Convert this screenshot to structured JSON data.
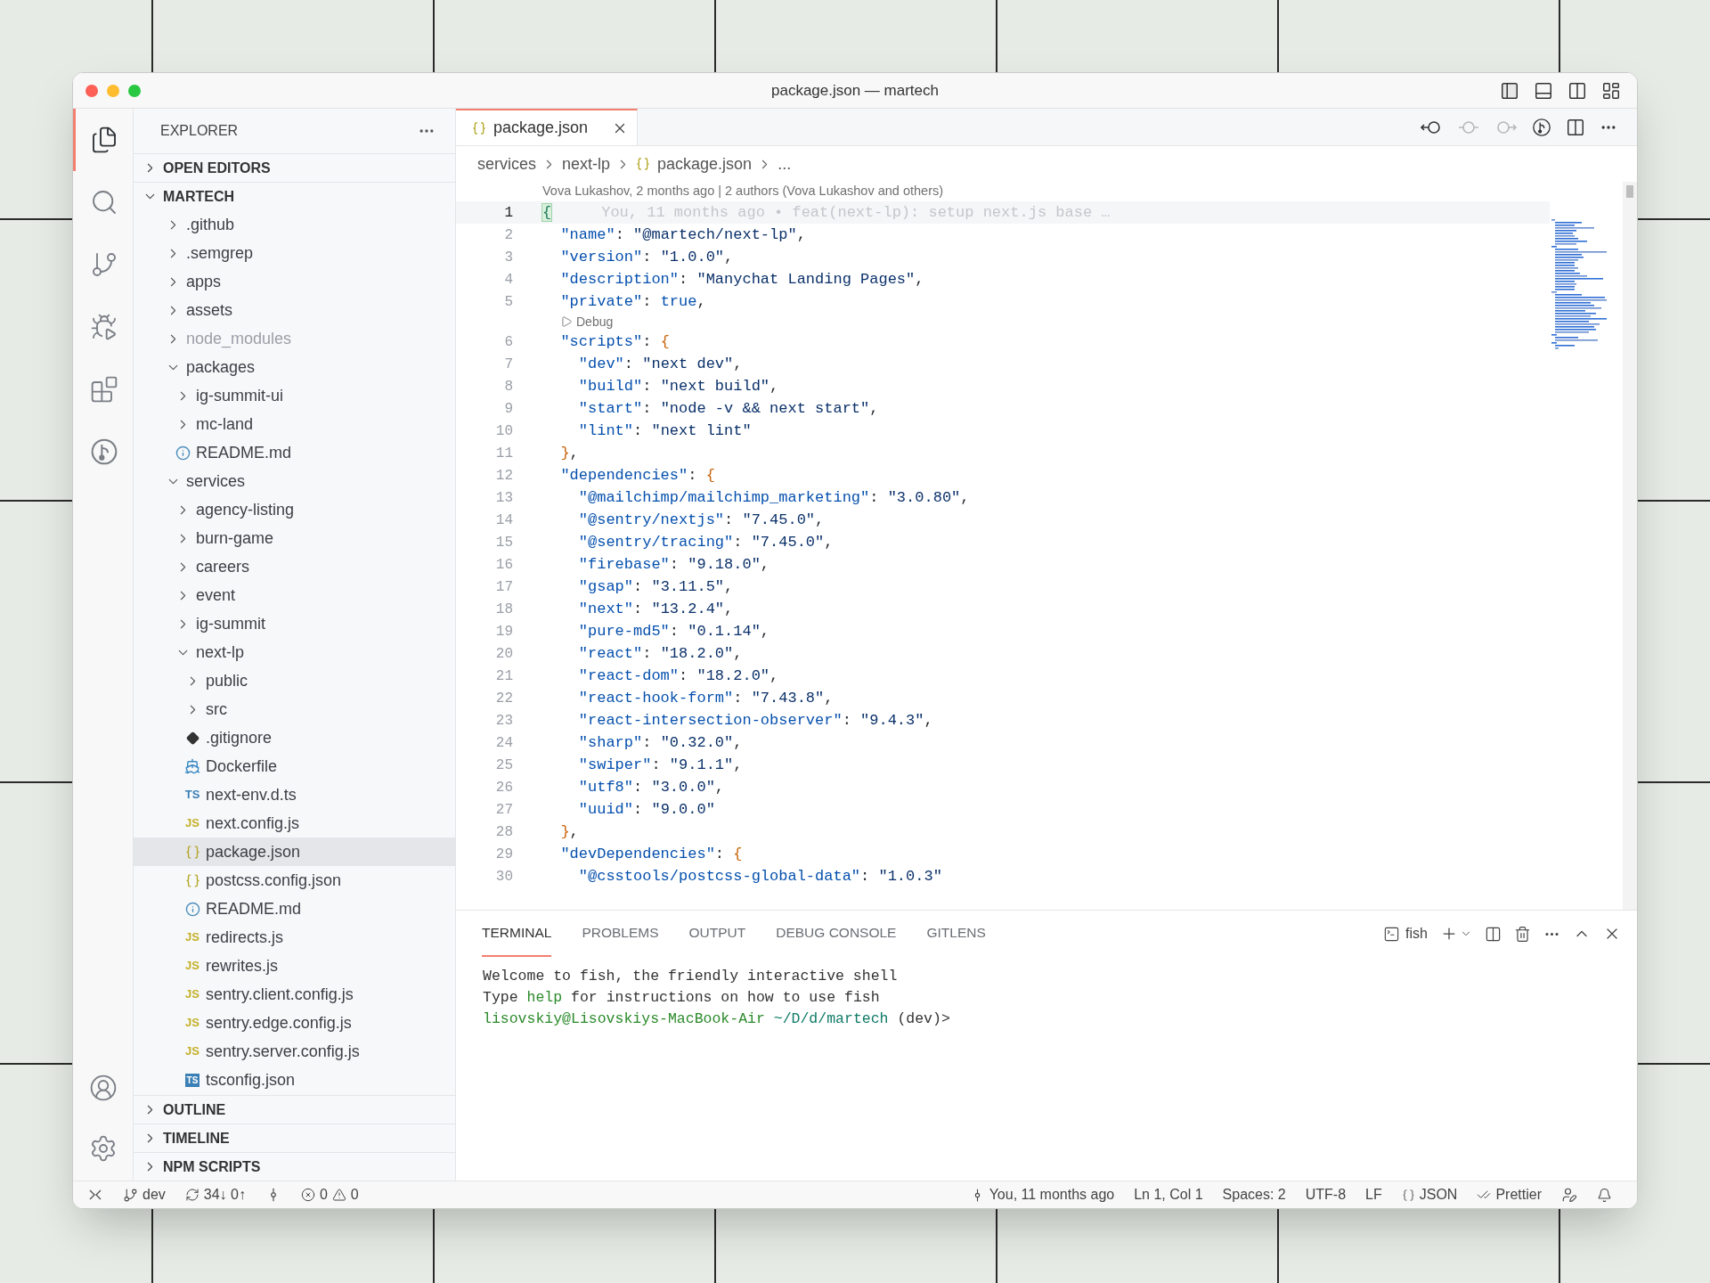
{
  "window": {
    "title": "package.json — martech"
  },
  "activity_bar": [
    {
      "kind": "explorer",
      "selected": true
    },
    {
      "kind": "search",
      "selected": false
    },
    {
      "kind": "source-control",
      "selected": false
    },
    {
      "kind": "run-debug",
      "selected": false
    },
    {
      "kind": "extensions",
      "selected": false
    },
    {
      "kind": "gitlens",
      "selected": false
    }
  ],
  "activity_bar_bottom": [
    {
      "kind": "account"
    },
    {
      "kind": "settings"
    }
  ],
  "sidebar": {
    "title": "EXPLORER",
    "sections_top": [
      {
        "label": "OPEN EDITORS",
        "expanded": false
      }
    ],
    "workspace": {
      "label": "MARTECH",
      "expanded": true
    },
    "tree": [
      {
        "label": ".github",
        "kind": "folder",
        "expanded": false,
        "ignored": false,
        "selected": false
      },
      {
        "label": ".semgrep",
        "kind": "folder",
        "expanded": false,
        "ignored": false,
        "selected": false
      },
      {
        "label": "apps",
        "kind": "folder",
        "expanded": false,
        "ignored": false,
        "selected": false
      },
      {
        "label": "assets",
        "kind": "folder",
        "expanded": false,
        "ignored": false,
        "selected": false
      },
      {
        "label": "node_modules",
        "kind": "folder",
        "expanded": false,
        "ignored": true,
        "selected": false
      },
      {
        "label": "packages",
        "kind": "folder",
        "expanded": true,
        "ignored": false,
        "selected": false,
        "children": [
          {
            "label": "ig-summit-ui",
            "kind": "folder",
            "expanded": false,
            "ignored": false,
            "selected": false
          },
          {
            "label": "mc-land",
            "kind": "folder",
            "expanded": false,
            "ignored": false,
            "selected": false
          },
          {
            "label": "README.md",
            "kind": "info",
            "ignored": false,
            "selected": false
          }
        ]
      },
      {
        "label": "services",
        "kind": "folder",
        "expanded": true,
        "ignored": false,
        "selected": false,
        "children": [
          {
            "label": "agency-listing",
            "kind": "folder",
            "expanded": false,
            "ignored": false,
            "selected": false
          },
          {
            "label": "burn-game",
            "kind": "folder",
            "expanded": false,
            "ignored": false,
            "selected": false
          },
          {
            "label": "careers",
            "kind": "folder",
            "expanded": false,
            "ignored": false,
            "selected": false
          },
          {
            "label": "event",
            "kind": "folder",
            "expanded": false,
            "ignored": false,
            "selected": false
          },
          {
            "label": "ig-summit",
            "kind": "folder",
            "expanded": false,
            "ignored": false,
            "selected": false
          },
          {
            "label": "next-lp",
            "kind": "folder",
            "expanded": true,
            "ignored": false,
            "selected": false,
            "children": [
              {
                "label": "public",
                "kind": "folder",
                "expanded": false,
                "ignored": false,
                "selected": false
              },
              {
                "label": "src",
                "kind": "folder",
                "expanded": false,
                "ignored": false,
                "selected": false
              },
              {
                "label": ".gitignore",
                "kind": "git",
                "ignored": false,
                "selected": false
              },
              {
                "label": "Dockerfile",
                "kind": "docker",
                "ignored": false,
                "selected": false
              },
              {
                "label": "next-env.d.ts",
                "kind": "ts",
                "glyph": "TS",
                "ignored": false,
                "selected": false
              },
              {
                "label": "next.config.js",
                "kind": "js",
                "glyph": "JS",
                "ignored": false,
                "selected": false
              },
              {
                "label": "package.json",
                "kind": "json",
                "ignored": false,
                "selected": true
              },
              {
                "label": "postcss.config.json",
                "kind": "json",
                "ignored": false,
                "selected": false
              },
              {
                "label": "README.md",
                "kind": "info",
                "ignored": false,
                "selected": false
              },
              {
                "label": "redirects.js",
                "kind": "js",
                "glyph": "JS",
                "ignored": false,
                "selected": false
              },
              {
                "label": "rewrites.js",
                "kind": "js",
                "glyph": "JS",
                "ignored": false,
                "selected": false
              },
              {
                "label": "sentry.client.config.js",
                "kind": "js",
                "glyph": "JS",
                "ignored": false,
                "selected": false
              },
              {
                "label": "sentry.edge.config.js",
                "kind": "js",
                "glyph": "JS",
                "ignored": false,
                "selected": false
              },
              {
                "label": "sentry.server.config.js",
                "kind": "js",
                "glyph": "JS",
                "ignored": false,
                "selected": false
              },
              {
                "label": "tsconfig.json",
                "kind": "tsbox",
                "glyph": "TS",
                "ignored": false,
                "selected": false
              }
            ]
          }
        ]
      }
    ],
    "sections_bottom": [
      {
        "label": "OUTLINE",
        "expanded": false
      },
      {
        "label": "TIMELINE",
        "expanded": false
      },
      {
        "label": "NPM SCRIPTS",
        "expanded": false
      }
    ]
  },
  "tabs": [
    {
      "label": "package.json",
      "kind": "json",
      "selected": true
    }
  ],
  "breadcrumbs": [
    {
      "label": "services",
      "kind": "folder"
    },
    {
      "label": "next-lp",
      "kind": "folder"
    },
    {
      "label": "package.json",
      "kind": "json"
    },
    {
      "label": "...",
      "kind": "symbol"
    }
  ],
  "editor": {
    "blame_header": "Vova Lukashov, 2 months ago | 2 authors (Vova Lukashov and others)",
    "lines": [
      {
        "number": "1",
        "current": true,
        "blame": "You, 11 months ago • feat(next-lp): setup next.js base …",
        "tokens": [
          {
            "text": "{",
            "kind": "match"
          }
        ]
      },
      {
        "number": "2",
        "current": false,
        "tokens": [
          {
            "text": "  \"name\"",
            "kind": "key"
          },
          {
            "text": ": ",
            "kind": "punct"
          },
          {
            "text": "\"@martech/next-lp\"",
            "kind": "str"
          },
          {
            "text": ",",
            "kind": "punct"
          }
        ]
      },
      {
        "number": "3",
        "current": false,
        "tokens": [
          {
            "text": "  \"version\"",
            "kind": "key"
          },
          {
            "text": ": ",
            "kind": "punct"
          },
          {
            "text": "\"1.0.0\"",
            "kind": "str"
          },
          {
            "text": ",",
            "kind": "punct"
          }
        ]
      },
      {
        "number": "4",
        "current": false,
        "tokens": [
          {
            "text": "  \"description\"",
            "kind": "key"
          },
          {
            "text": ": ",
            "kind": "punct"
          },
          {
            "text": "\"Manychat Landing Pages\"",
            "kind": "str"
          },
          {
            "text": ",",
            "kind": "punct"
          }
        ]
      },
      {
        "number": "5",
        "current": false,
        "lens": "Debug",
        "tokens": [
          {
            "text": "  \"private\"",
            "kind": "key"
          },
          {
            "text": ": ",
            "kind": "punct"
          },
          {
            "text": "true",
            "kind": "kw"
          },
          {
            "text": ",",
            "kind": "punct"
          }
        ]
      },
      {
        "number": "6",
        "current": false,
        "tokens": [
          {
            "text": "  \"scripts\"",
            "kind": "key"
          },
          {
            "text": ": ",
            "kind": "punct"
          },
          {
            "text": "{",
            "kind": "bracket"
          }
        ]
      },
      {
        "number": "7",
        "current": false,
        "tokens": [
          {
            "text": "    \"dev\"",
            "kind": "key"
          },
          {
            "text": ": ",
            "kind": "punct"
          },
          {
            "text": "\"next dev\"",
            "kind": "str"
          },
          {
            "text": ",",
            "kind": "punct"
          }
        ]
      },
      {
        "number": "8",
        "current": false,
        "tokens": [
          {
            "text": "    \"build\"",
            "kind": "key"
          },
          {
            "text": ": ",
            "kind": "punct"
          },
          {
            "text": "\"next build\"",
            "kind": "str"
          },
          {
            "text": ",",
            "kind": "punct"
          }
        ]
      },
      {
        "number": "9",
        "current": false,
        "tokens": [
          {
            "text": "    \"start\"",
            "kind": "key"
          },
          {
            "text": ": ",
            "kind": "punct"
          },
          {
            "text": "\"node -v && next start\"",
            "kind": "str"
          },
          {
            "text": ",",
            "kind": "punct"
          }
        ]
      },
      {
        "number": "10",
        "current": false,
        "tokens": [
          {
            "text": "    \"lint\"",
            "kind": "key"
          },
          {
            "text": ": ",
            "kind": "punct"
          },
          {
            "text": "\"next lint\"",
            "kind": "str"
          }
        ]
      },
      {
        "number": "11",
        "current": false,
        "tokens": [
          {
            "text": "  }",
            "kind": "bracket"
          },
          {
            "text": ",",
            "kind": "punct"
          }
        ]
      },
      {
        "number": "12",
        "current": false,
        "tokens": [
          {
            "text": "  \"dependencies\"",
            "kind": "key"
          },
          {
            "text": ": ",
            "kind": "punct"
          },
          {
            "text": "{",
            "kind": "bracket"
          }
        ]
      },
      {
        "number": "13",
        "current": false,
        "tokens": [
          {
            "text": "    \"@mailchimp/mailchimp_marketing\"",
            "kind": "key"
          },
          {
            "text": ": ",
            "kind": "punct"
          },
          {
            "text": "\"3.0.80\"",
            "kind": "str"
          },
          {
            "text": ",",
            "kind": "punct"
          }
        ]
      },
      {
        "number": "14",
        "current": false,
        "tokens": [
          {
            "text": "    \"@sentry/nextjs\"",
            "kind": "key"
          },
          {
            "text": ": ",
            "kind": "punct"
          },
          {
            "text": "\"7.45.0\"",
            "kind": "str"
          },
          {
            "text": ",",
            "kind": "punct"
          }
        ]
      },
      {
        "number": "15",
        "current": false,
        "tokens": [
          {
            "text": "    \"@sentry/tracing\"",
            "kind": "key"
          },
          {
            "text": ": ",
            "kind": "punct"
          },
          {
            "text": "\"7.45.0\"",
            "kind": "str"
          },
          {
            "text": ",",
            "kind": "punct"
          }
        ]
      },
      {
        "number": "16",
        "current": false,
        "tokens": [
          {
            "text": "    \"firebase\"",
            "kind": "key"
          },
          {
            "text": ": ",
            "kind": "punct"
          },
          {
            "text": "\"9.18.0\"",
            "kind": "str"
          },
          {
            "text": ",",
            "kind": "punct"
          }
        ]
      },
      {
        "number": "17",
        "current": false,
        "tokens": [
          {
            "text": "    \"gsap\"",
            "kind": "key"
          },
          {
            "text": ": ",
            "kind": "punct"
          },
          {
            "text": "\"3.11.5\"",
            "kind": "str"
          },
          {
            "text": ",",
            "kind": "punct"
          }
        ]
      },
      {
        "number": "18",
        "current": false,
        "tokens": [
          {
            "text": "    \"next\"",
            "kind": "key"
          },
          {
            "text": ": ",
            "kind": "punct"
          },
          {
            "text": "\"13.2.4\"",
            "kind": "str"
          },
          {
            "text": ",",
            "kind": "punct"
          }
        ]
      },
      {
        "number": "19",
        "current": false,
        "tokens": [
          {
            "text": "    \"pure-md5\"",
            "kind": "key"
          },
          {
            "text": ": ",
            "kind": "punct"
          },
          {
            "text": "\"0.1.14\"",
            "kind": "str"
          },
          {
            "text": ",",
            "kind": "punct"
          }
        ]
      },
      {
        "number": "20",
        "current": false,
        "tokens": [
          {
            "text": "    \"react\"",
            "kind": "key"
          },
          {
            "text": ": ",
            "kind": "punct"
          },
          {
            "text": "\"18.2.0\"",
            "kind": "str"
          },
          {
            "text": ",",
            "kind": "punct"
          }
        ]
      },
      {
        "number": "21",
        "current": false,
        "tokens": [
          {
            "text": "    \"react-dom\"",
            "kind": "key"
          },
          {
            "text": ": ",
            "kind": "punct"
          },
          {
            "text": "\"18.2.0\"",
            "kind": "str"
          },
          {
            "text": ",",
            "kind": "punct"
          }
        ]
      },
      {
        "number": "22",
        "current": false,
        "tokens": [
          {
            "text": "    \"react-hook-form\"",
            "kind": "key"
          },
          {
            "text": ": ",
            "kind": "punct"
          },
          {
            "text": "\"7.43.8\"",
            "kind": "str"
          },
          {
            "text": ",",
            "kind": "punct"
          }
        ]
      },
      {
        "number": "23",
        "current": false,
        "tokens": [
          {
            "text": "    \"react-intersection-observer\"",
            "kind": "key"
          },
          {
            "text": ": ",
            "kind": "punct"
          },
          {
            "text": "\"9.4.3\"",
            "kind": "str"
          },
          {
            "text": ",",
            "kind": "punct"
          }
        ]
      },
      {
        "number": "24",
        "current": false,
        "tokens": [
          {
            "text": "    \"sharp\"",
            "kind": "key"
          },
          {
            "text": ": ",
            "kind": "punct"
          },
          {
            "text": "\"0.32.0\"",
            "kind": "str"
          },
          {
            "text": ",",
            "kind": "punct"
          }
        ]
      },
      {
        "number": "25",
        "current": false,
        "tokens": [
          {
            "text": "    \"swiper\"",
            "kind": "key"
          },
          {
            "text": ": ",
            "kind": "punct"
          },
          {
            "text": "\"9.1.1\"",
            "kind": "str"
          },
          {
            "text": ",",
            "kind": "punct"
          }
        ]
      },
      {
        "number": "26",
        "current": false,
        "tokens": [
          {
            "text": "    \"utf8\"",
            "kind": "key"
          },
          {
            "text": ": ",
            "kind": "punct"
          },
          {
            "text": "\"3.0.0\"",
            "kind": "str"
          },
          {
            "text": ",",
            "kind": "punct"
          }
        ]
      },
      {
        "number": "27",
        "current": false,
        "tokens": [
          {
            "text": "    \"uuid\"",
            "kind": "key"
          },
          {
            "text": ": ",
            "kind": "punct"
          },
          {
            "text": "\"9.0.0\"",
            "kind": "str"
          }
        ]
      },
      {
        "number": "28",
        "current": false,
        "tokens": [
          {
            "text": "  }",
            "kind": "bracket"
          },
          {
            "text": ",",
            "kind": "punct"
          }
        ]
      },
      {
        "number": "29",
        "current": false,
        "tokens": [
          {
            "text": "  \"devDependencies\"",
            "kind": "key"
          },
          {
            "text": ": ",
            "kind": "punct"
          },
          {
            "text": "{",
            "kind": "bracket"
          }
        ]
      },
      {
        "number": "30",
        "current": false,
        "tokens": [
          {
            "text": "    \"@csstools/postcss-global-data\"",
            "kind": "key"
          },
          {
            "text": ": ",
            "kind": "punct"
          },
          {
            "text": "\"1.0.3\"",
            "kind": "str"
          }
        ]
      }
    ]
  },
  "panel": {
    "tabs": [
      {
        "label": "TERMINAL",
        "selected": true
      },
      {
        "label": "PROBLEMS",
        "selected": false
      },
      {
        "label": "OUTPUT",
        "selected": false
      },
      {
        "label": "DEBUG CONSOLE",
        "selected": false
      },
      {
        "label": "GITLENS",
        "selected": false
      }
    ],
    "terminal_profile": "fish",
    "terminal_lines": [
      [
        {
          "text": "Welcome to fish, the friendly interactive shell",
          "kind": "plain"
        }
      ],
      [
        {
          "text": "Type ",
          "kind": "plain"
        },
        {
          "text": "help",
          "kind": "green"
        },
        {
          "text": " for instructions on how to use fish",
          "kind": "plain"
        }
      ],
      [
        {
          "text": "lisovskiy@Lisovskiys-MacBook-Air",
          "kind": "green"
        },
        {
          "text": " ~/D/d/martech",
          "kind": "teal"
        },
        {
          "text": " (dev)>",
          "kind": "plain"
        }
      ]
    ]
  },
  "status_bar": {
    "left": [
      {
        "kind": "remote"
      },
      {
        "kind": "branch",
        "text": "dev"
      },
      {
        "kind": "sync",
        "text": "34↓ 0↑"
      },
      {
        "kind": "graph"
      },
      {
        "kind": "problems",
        "errors": "0",
        "warnings": "0"
      }
    ],
    "right": [
      {
        "kind": "blame",
        "text": "You, 11 months ago"
      },
      {
        "kind": "text",
        "text": "Ln 1, Col 1"
      },
      {
        "kind": "text",
        "text": "Spaces: 2"
      },
      {
        "kind": "text",
        "text": "UTF-8"
      },
      {
        "kind": "text",
        "text": "LF"
      },
      {
        "kind": "language",
        "text": "JSON"
      },
      {
        "kind": "formatter",
        "text": "Prettier"
      },
      {
        "kind": "feedback"
      },
      {
        "kind": "bell"
      }
    ]
  }
}
